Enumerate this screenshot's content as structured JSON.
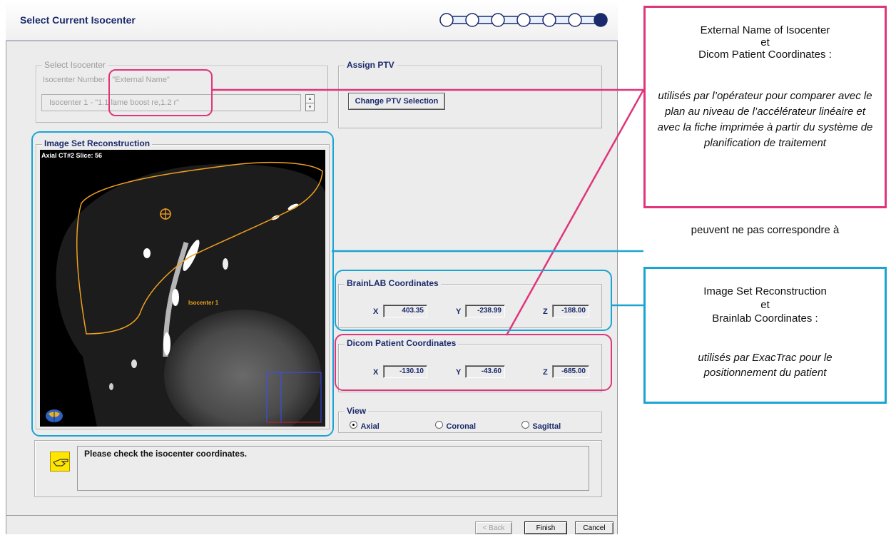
{
  "window": {
    "title": "Select Current Isocenter",
    "wizard_steps": 7,
    "active_step": 7
  },
  "select_isocenter": {
    "legend": "Select Isocenter",
    "header": "Isocenter Number - \"External Name\"",
    "value": "Isocenter 1   -   \"1.1 lame boost re,1.2 r\""
  },
  "assign_ptv": {
    "legend": "Assign PTV",
    "button": "Change PTV Selection"
  },
  "image_set": {
    "legend": "Image Set Reconstruction",
    "overlay": "Axial CT#2   Slice: 56",
    "isocenter_label": "Isocenter 1"
  },
  "brainlab": {
    "legend": "BrainLAB Coordinates",
    "x_label": "X",
    "x": "403.35",
    "y_label": "Y",
    "y": "-238.99",
    "z_label": "Z",
    "z": "-188.00"
  },
  "dicom": {
    "legend": "Dicom Patient Coordinates",
    "x_label": "X",
    "x": "-130.10",
    "y_label": "Y",
    "y": "-43.60",
    "z_label": "Z",
    "z": "-685.00"
  },
  "view": {
    "legend": "View",
    "options": [
      "Axial",
      "Coronal",
      "Sagittal"
    ],
    "selected": "Axial"
  },
  "message": "Please check the isocenter coordinates.",
  "buttons": {
    "back": "< Back",
    "finish": "Finish",
    "cancel": "Cancel"
  },
  "annotations": {
    "pink": {
      "title_line1": "External Name of Isocenter",
      "title_line2": "et",
      "title_line3": "Dicom Patient Coordinates :",
      "body": "utilisés par l’opérateur pour comparer avec le plan au niveau de l’accélérateur linéaire et avec la fiche imprimée à partir du système de planification de traitement"
    },
    "middle_text": "peuvent ne pas correspondre à",
    "blue": {
      "title_line1": "Image Set Reconstruction",
      "title_line2": "et",
      "title_line3": "Brainlab Coordinates :",
      "body": "utilisés par ExacTrac pour le positionnement du patient"
    }
  },
  "colors": {
    "pink": "#e0357a",
    "blue": "#1aa4d4",
    "title_blue": "#1a2a6c",
    "contour": "#f0a020"
  }
}
